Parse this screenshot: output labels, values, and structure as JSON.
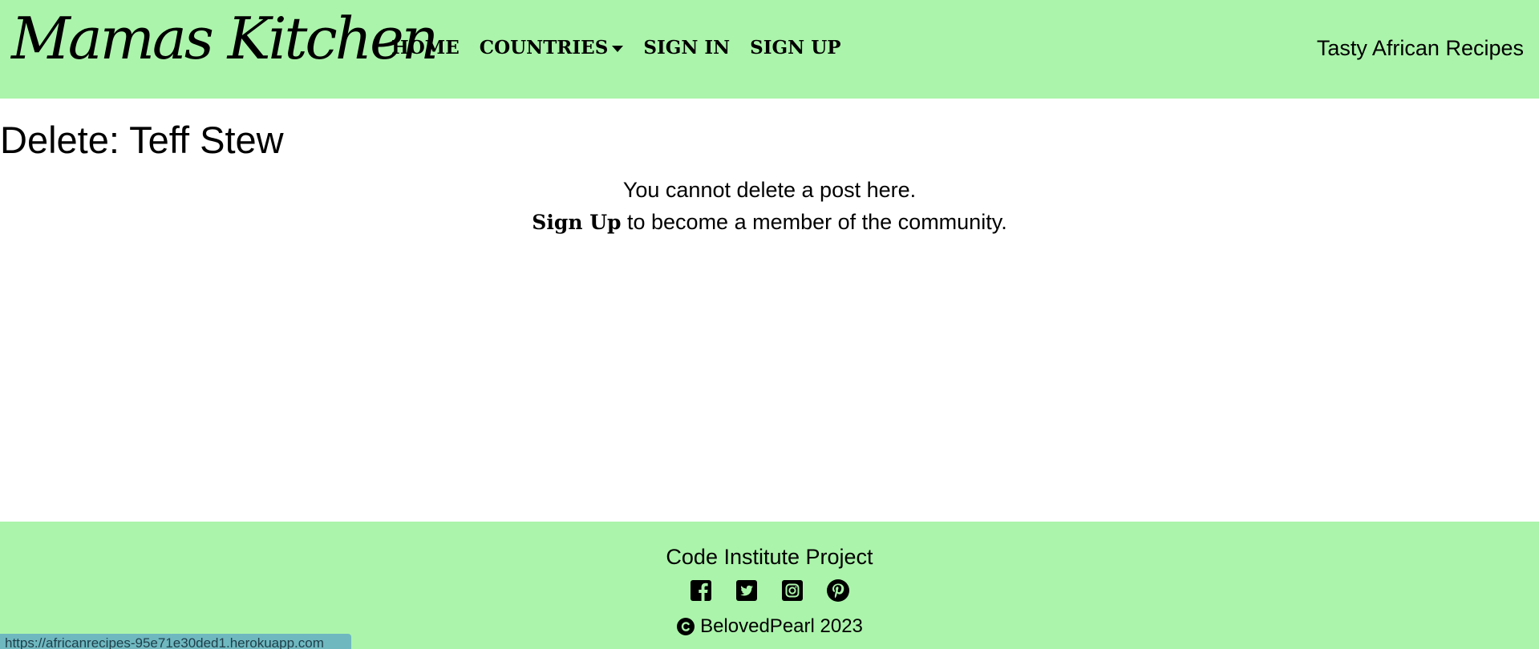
{
  "navbar": {
    "brand": "Mamas Kitchen",
    "links": {
      "home": "HOME",
      "countries": "COUNTRIES",
      "sign_in": "SIGN IN",
      "sign_up": "SIGN UP"
    },
    "tagline": "Tasty African Recipes",
    "background": "#abf4ab"
  },
  "main": {
    "title": "Delete: Teff Stew",
    "message_line1": "You cannot delete a post here.",
    "signup_link": "Sign Up",
    "message_line2_rest": "to become a member of the community."
  },
  "footer": {
    "title": "Code Institute Project",
    "social_icons": [
      "facebook-icon",
      "twitter-icon",
      "instagram-icon",
      "pinterest-icon"
    ],
    "copyright": "BelovedPearl 2023"
  },
  "status_bar": {
    "url": "https://africanrecipes-95e71e30ded1.herokuapp.com"
  }
}
